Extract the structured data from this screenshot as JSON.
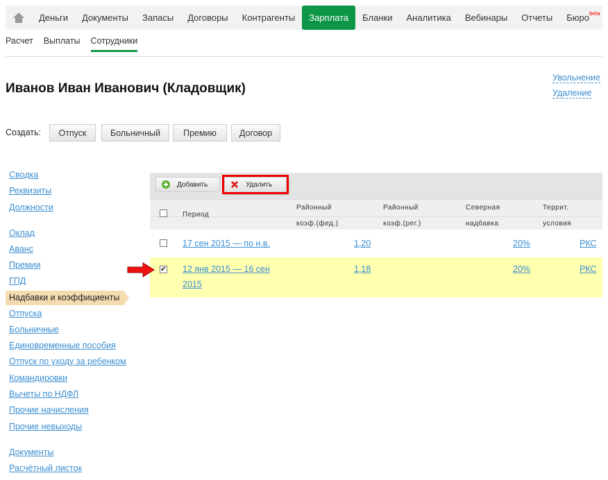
{
  "nav": {
    "items": [
      "Деньги",
      "Документы",
      "Запасы",
      "Договоры",
      "Контрагенты",
      "Зарплата",
      "Бланки",
      "Аналитика",
      "Вебинары",
      "Отчеты",
      "Бюро"
    ],
    "active": "Зарплата",
    "beta": "beta",
    "accent": "#0e9648"
  },
  "subnav": [
    "Расчет",
    "Выплаты",
    "Сотрудники"
  ],
  "title": "Иванов Иван Иванович (Кладовщик)",
  "actions": {
    "dismiss": "Увольнение",
    "delete": "Удаление"
  },
  "create": {
    "label": "Создать:",
    "buttons": [
      "Отпуск",
      "Больничный",
      "Премию",
      "Договор"
    ]
  },
  "sidebar": {
    "groups": [
      [
        "Сводка",
        "Реквизиты",
        "Должности"
      ],
      [
        "Оклад",
        "Аванс",
        "Премии",
        "ГПД",
        "Надбавки и коэффициенты",
        "Отпуска",
        "Больничные",
        "Единовременные пособия",
        "Отпуск по уходу за ребенком",
        "Командировки",
        "Вычеты по НДФЛ",
        "Прочие начисления",
        "Прочие невыходы"
      ],
      [
        "Документы",
        "Расчётный листок"
      ]
    ],
    "active": "Надбавки и коэффициенты"
  },
  "toolbar": {
    "add": "Добавить",
    "delete": "Удалить"
  },
  "table": {
    "headers": {
      "period": "Период",
      "fed1": "Районный",
      "fed2": "коэф.(фед.)",
      "reg1": "Районный",
      "reg2": "коэф.(рег.)",
      "north1": "Северная",
      "north2": "надбавка",
      "terr1": "Террит.",
      "terr2": "условия"
    },
    "rows": [
      {
        "period": "17 сен 2015 — по н.в.",
        "fed": "1,20",
        "north": "20%",
        "terr": "РКС",
        "checked": false
      },
      {
        "period": "12 янв 2015 — 16 сен 2015",
        "fed": "1,18",
        "north": "20%",
        "terr": "РКС",
        "checked": true
      }
    ]
  }
}
